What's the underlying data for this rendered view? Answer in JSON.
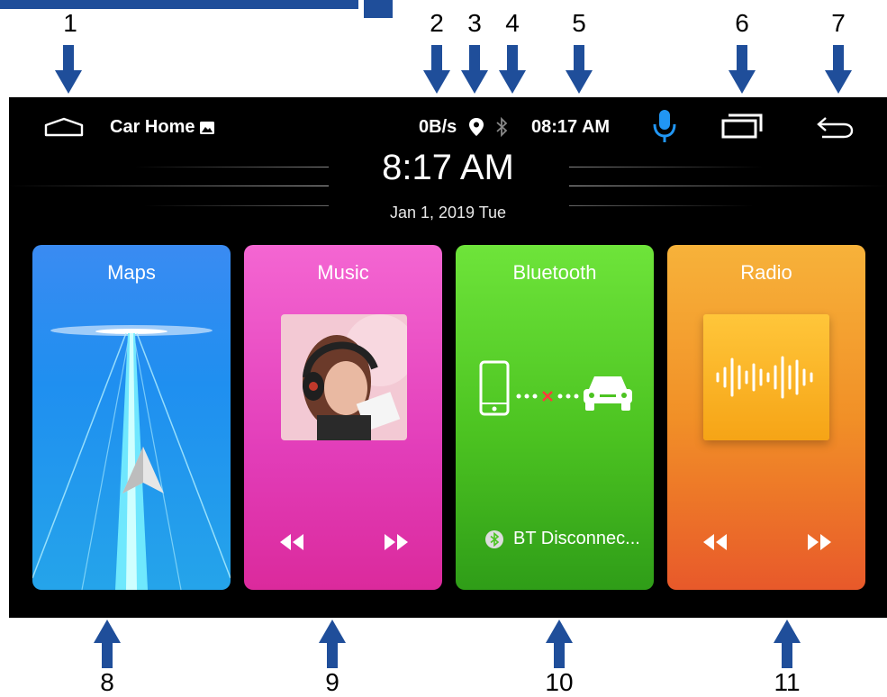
{
  "callouts": [
    "1",
    "2",
    "3",
    "4",
    "5",
    "6",
    "7",
    "8",
    "9",
    "10",
    "11"
  ],
  "status_bar": {
    "app_name": "Car Home",
    "network_speed": "0B/s",
    "time": "08:17 AM"
  },
  "clock": {
    "time": "8:17 AM",
    "date": "Jan 1, 2019  Tue"
  },
  "cards": {
    "maps": {
      "title": "Maps"
    },
    "music": {
      "title": "Music"
    },
    "bluetooth": {
      "title": "Bluetooth",
      "status": "BT Disconnec..."
    },
    "radio": {
      "title": "Radio"
    }
  },
  "icons": [
    "home-icon",
    "picture-icon",
    "location-icon",
    "bluetooth-icon",
    "microphone-icon",
    "recent-apps-icon",
    "back-icon",
    "navigation-arrow-icon",
    "rewind-icon",
    "fast-forward-icon",
    "phone-icon",
    "car-icon",
    "sound-wave-icon"
  ],
  "colors": {
    "callout_arrow": "#1f4e9a",
    "mic_accent": "#2196f3",
    "maps": "#2b8ff0",
    "music": "#e53dbd",
    "bluetooth": "#4cc321",
    "radio": "#f19027"
  }
}
